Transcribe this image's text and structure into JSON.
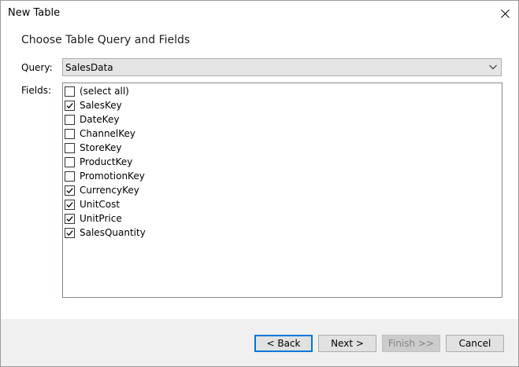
{
  "window": {
    "title": "New Table"
  },
  "heading": "Choose Table Query and Fields",
  "query": {
    "label": "Query:",
    "value": "SalesData"
  },
  "fields": {
    "label": "Fields:",
    "items": [
      {
        "label": "(select all)",
        "checked": false
      },
      {
        "label": "SalesKey",
        "checked": true
      },
      {
        "label": "DateKey",
        "checked": false
      },
      {
        "label": "ChannelKey",
        "checked": false
      },
      {
        "label": "StoreKey",
        "checked": false
      },
      {
        "label": "ProductKey",
        "checked": false
      },
      {
        "label": "PromotionKey",
        "checked": false
      },
      {
        "label": "CurrencyKey",
        "checked": true
      },
      {
        "label": "UnitCost",
        "checked": true
      },
      {
        "label": "UnitPrice",
        "checked": true
      },
      {
        "label": "SalesQuantity",
        "checked": true
      }
    ]
  },
  "buttons": {
    "back": "< Back",
    "next": "Next >",
    "finish": "Finish >>",
    "cancel": "Cancel"
  },
  "icons": {
    "close": "close-icon",
    "dropdown": "chevron-down-icon",
    "check": "checkmark-icon"
  },
  "colors": {
    "accent": "#0078d7",
    "footer_bg": "#f0f0f0",
    "select_bg": "#e5e5e5"
  }
}
